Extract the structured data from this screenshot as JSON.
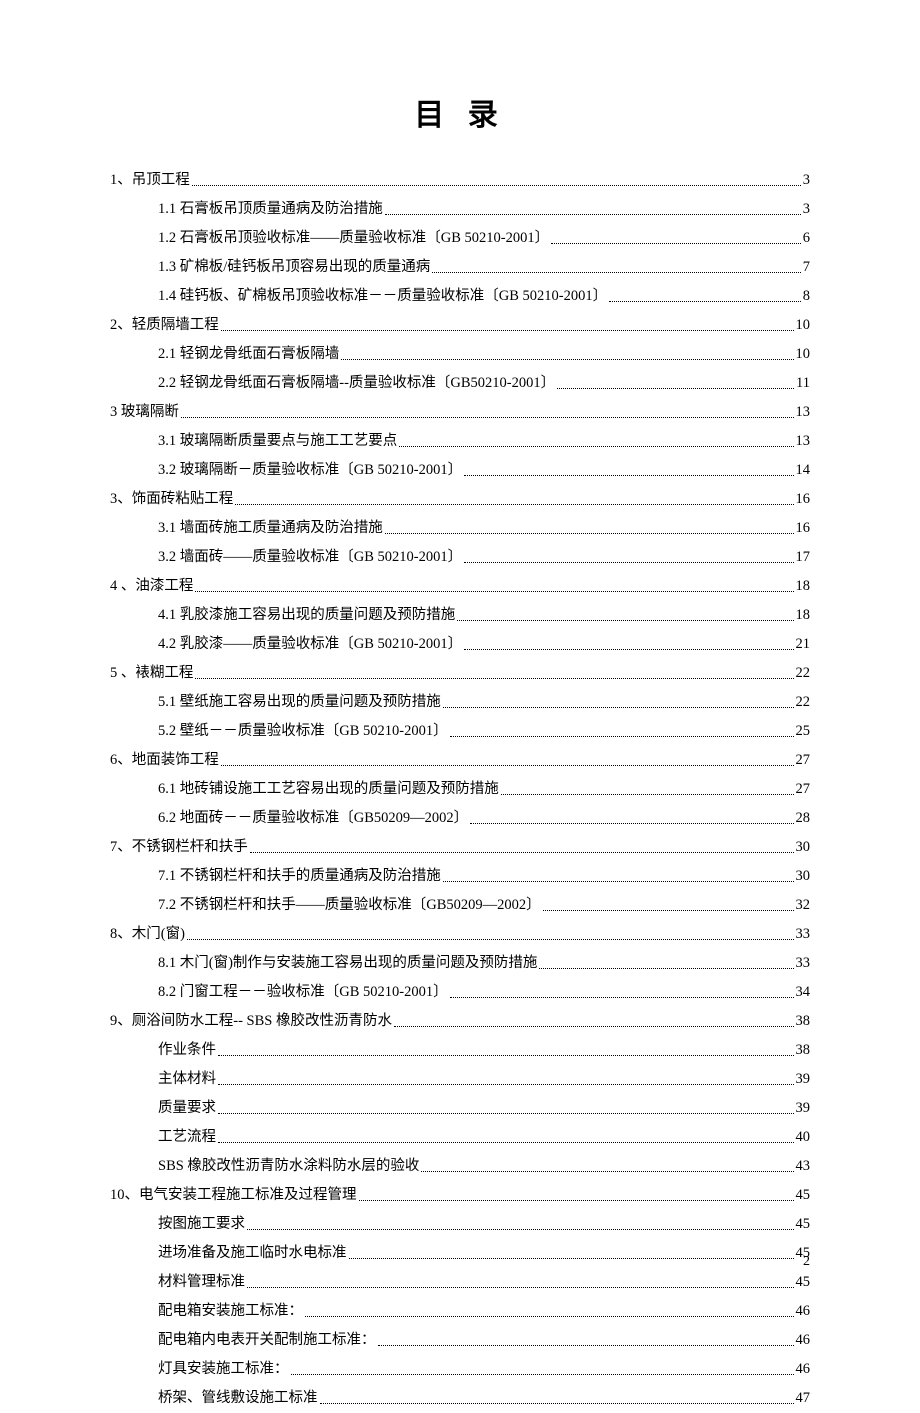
{
  "title": "目 录",
  "pageNumber": "2",
  "entries": [
    {
      "level": 1,
      "label": "1、吊顶工程",
      "page": "3"
    },
    {
      "level": 2,
      "label": "1.1 石膏板吊顶质量通病及防治措施",
      "page": "3"
    },
    {
      "level": 2,
      "label": "1.2 石膏板吊顶验收标准——质量验收标准〔GB 50210-2001〕",
      "page": "6"
    },
    {
      "level": 2,
      "label": "1.3 矿棉板/硅钙板吊顶容易出现的质量通病",
      "page": "7"
    },
    {
      "level": 2,
      "label": "1.4 硅钙板、矿棉板吊顶验收标准－－质量验收标准〔GB 50210-2001〕",
      "page": "8"
    },
    {
      "level": 1,
      "label": "2、轻质隔墙工程",
      "page": "10"
    },
    {
      "level": 2,
      "label": "2.1 轻钢龙骨纸面石膏板隔墙",
      "page": "10"
    },
    {
      "level": 2,
      "label": "2.2  轻钢龙骨纸面石膏板隔墙--质量验收标准〔GB50210-2001〕",
      "page": "11"
    },
    {
      "level": 1,
      "label": "3  玻璃隔断",
      "page": "13"
    },
    {
      "level": 2,
      "label": "3.1 玻璃隔断质量要点与施工工艺要点",
      "page": "13"
    },
    {
      "level": 2,
      "label": "3.2 玻璃隔断－质量验收标准〔GB 50210-2001〕",
      "page": "14"
    },
    {
      "level": 1,
      "label": "3、饰面砖粘贴工程",
      "page": "16"
    },
    {
      "level": 2,
      "label": "3.1 墙面砖施工质量通病及防治措施",
      "page": "16"
    },
    {
      "level": 2,
      "label": "3.2 墙面砖——质量验收标准〔GB 50210-2001〕",
      "page": "17"
    },
    {
      "level": 1,
      "label": "4 、油漆工程",
      "page": "18"
    },
    {
      "level": 2,
      "label": "4.1 乳胶漆施工容易出现的质量问题及预防措施",
      "page": "18"
    },
    {
      "level": 2,
      "label": "4.2 乳胶漆——质量验收标准〔GB 50210-2001〕",
      "page": "21"
    },
    {
      "level": 1,
      "label": "5 、裱糊工程",
      "page": "22"
    },
    {
      "level": 2,
      "label": "5.1 壁纸施工容易出现的质量问题及预防措施",
      "page": "22"
    },
    {
      "level": 2,
      "label": "5.2 壁纸－－质量验收标准〔GB 50210-2001〕",
      "page": "25"
    },
    {
      "level": 1,
      "label": "6、地面装饰工程",
      "page": "27"
    },
    {
      "level": 2,
      "label": "6.1 地砖铺设施工工艺容易出现的质量问题及预防措施",
      "page": "27"
    },
    {
      "level": 2,
      "label": "6.2 地面砖－－质量验收标准〔GB50209—2002〕",
      "page": "28"
    },
    {
      "level": 1,
      "label": "7、不锈钢栏杆和扶手",
      "page": "30"
    },
    {
      "level": 2,
      "label": "7.1 不锈钢栏杆和扶手的质量通病及防治措施",
      "page": "30"
    },
    {
      "level": 2,
      "label": "7.2 不锈钢栏杆和扶手——质量验收标准〔GB50209—2002〕",
      "page": "32"
    },
    {
      "level": 1,
      "label": "8、木门(窗)",
      "page": "33"
    },
    {
      "level": 2,
      "label": "8.1 木门(窗)制作与安装施工容易出现的质量问题及预防措施",
      "page": "33"
    },
    {
      "level": 2,
      "label": "8.2 门窗工程－－验收标准〔GB 50210-2001〕",
      "page": "34"
    },
    {
      "level": 1,
      "label": "9、厕浴间防水工程-- SBS 橡胶改性沥青防水",
      "page": "38"
    },
    {
      "level": 2,
      "label": "作业条件",
      "page": "38"
    },
    {
      "level": 2,
      "label": "主体材料",
      "page": "39"
    },
    {
      "level": 2,
      "label": "质量要求",
      "page": "39"
    },
    {
      "level": 2,
      "label": "工艺流程",
      "page": "40"
    },
    {
      "level": 2,
      "label": "SBS 橡胶改性沥青防水涂料防水层的验收",
      "page": "43"
    },
    {
      "level": 1,
      "label": "10、电气安装工程施工标准及过程管理",
      "page": "45"
    },
    {
      "level": 2,
      "label": "按图施工要求",
      "page": "45"
    },
    {
      "level": 2,
      "label": "进场准备及施工临时水电标准",
      "page": "45"
    },
    {
      "level": 2,
      "label": "材料管理标准",
      "page": "45"
    },
    {
      "level": 2,
      "label": "配电箱安装施工标准：",
      "page": "46"
    },
    {
      "level": 2,
      "label": "配电箱内电表开关配制施工标准：",
      "page": "46"
    },
    {
      "level": 2,
      "label": "灯具安装施工标准：",
      "page": "46"
    },
    {
      "level": 2,
      "label": "桥架、管线敷设施工标准",
      "page": "47"
    }
  ]
}
